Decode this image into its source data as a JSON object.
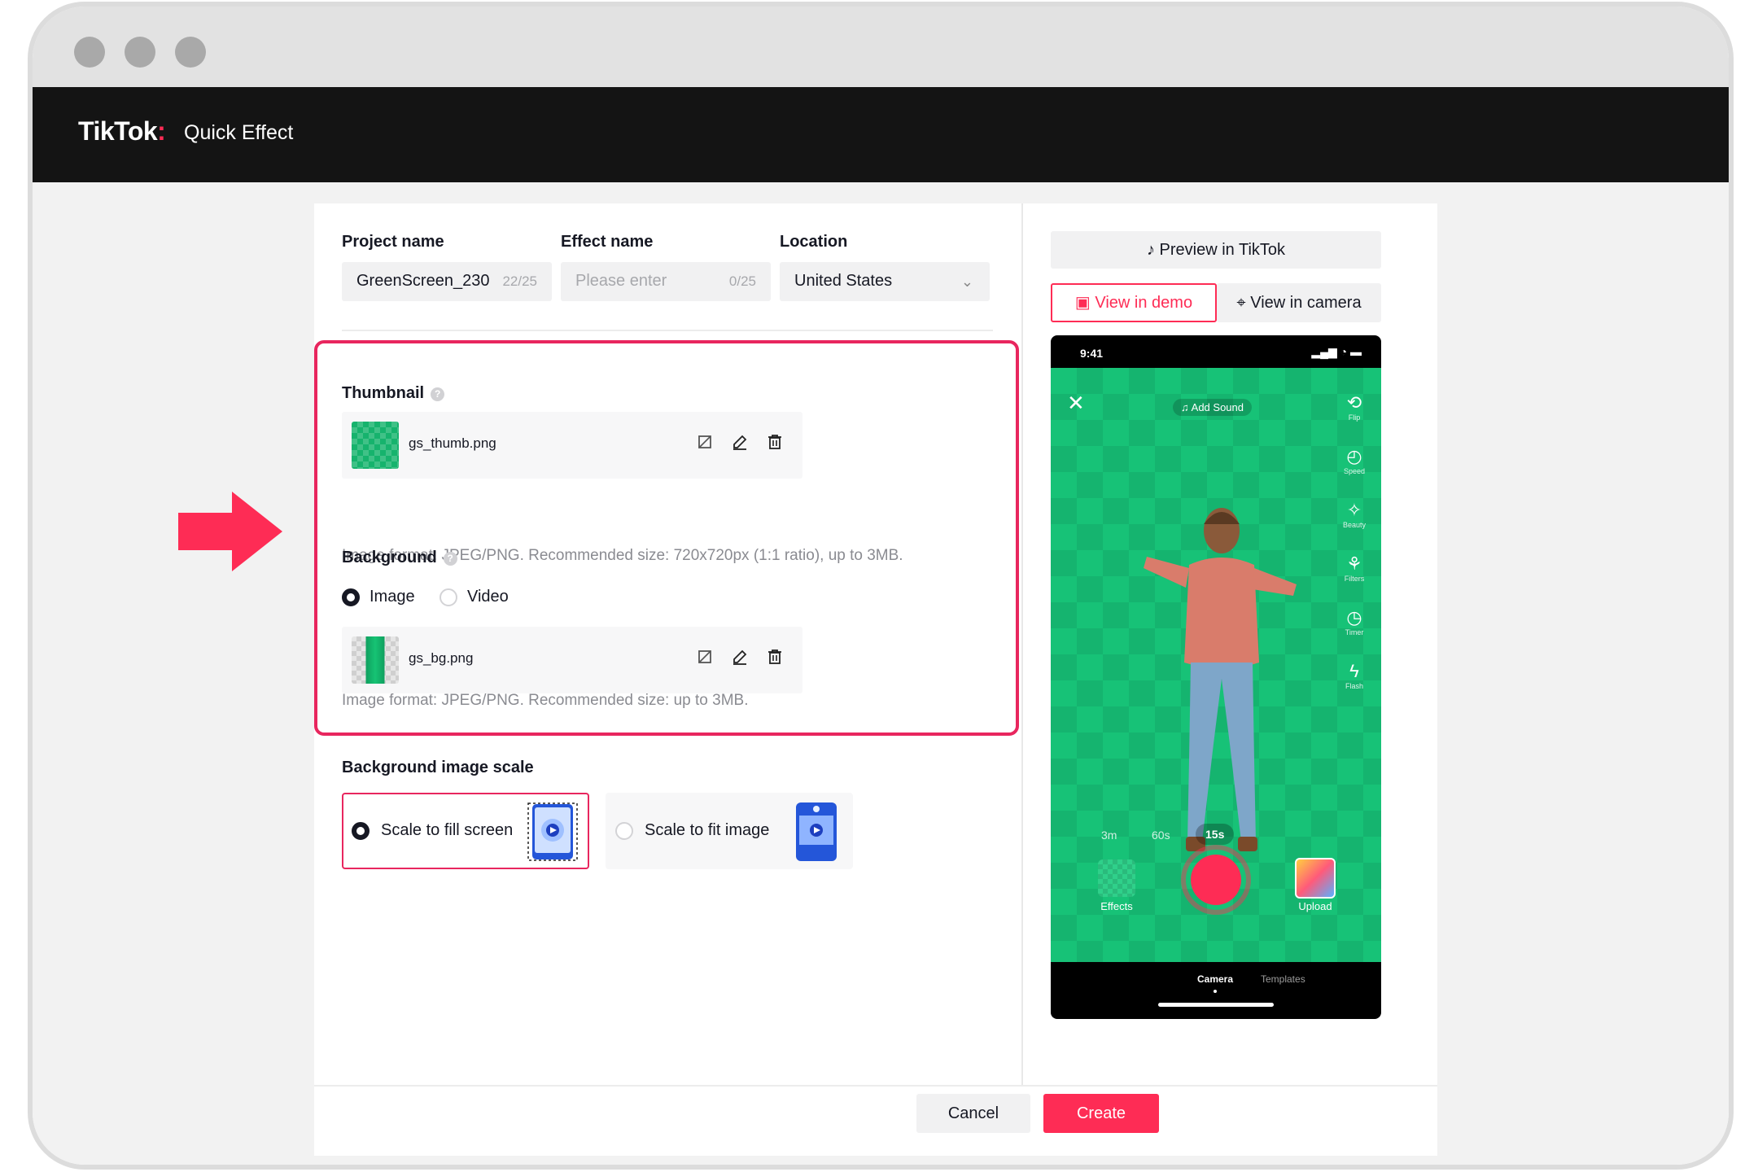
{
  "app": {
    "brand": "TikTok",
    "brand_colon": ":",
    "product": "Quick Effect"
  },
  "form": {
    "project_name": {
      "label": "Project name",
      "value": "GreenScreen_230",
      "count": "22/25"
    },
    "effect_name": {
      "label": "Effect name",
      "placeholder": "Please enter",
      "count": "0/25"
    },
    "location": {
      "label": "Location",
      "value": "United States"
    }
  },
  "thumbnail": {
    "label": "Thumbnail",
    "file": "gs_thumb.png",
    "hint": "Image format: JPEG/PNG. Recommended size: 720x720px (1:1 ratio), up to 3MB."
  },
  "background": {
    "label": "Background",
    "options": [
      "Image",
      "Video"
    ],
    "selected": "Image",
    "file": "gs_bg.png",
    "hint": "Image format: JPEG/PNG. Recommended size: up to 3MB."
  },
  "scale": {
    "label": "Background image scale",
    "options": [
      "Scale to fill screen",
      "Scale to fit image"
    ],
    "selected": "Scale to fill screen"
  },
  "preview": {
    "button": "Preview in TikTok",
    "tabs": [
      "View in demo",
      "View in camera"
    ],
    "active_tab": "View in demo",
    "phone": {
      "time": "9:41",
      "add_sound": "Add Sound",
      "side_tools": [
        "Flip",
        "Speed",
        "Beauty",
        "Filters",
        "Timer",
        "Flash"
      ],
      "durations": [
        "3m",
        "60s",
        "15s"
      ],
      "active_duration": "15s",
      "effects_label": "Effects",
      "upload_label": "Upload",
      "bottom_tabs": [
        "Camera",
        "Templates"
      ],
      "active_bottom_tab": "Camera"
    }
  },
  "actions": {
    "cancel": "Cancel",
    "create": "Create"
  },
  "colors": {
    "accent": "#fe2c55",
    "highlight": "#e8265e",
    "green_screen": "#17c277",
    "nav": "#141414"
  }
}
